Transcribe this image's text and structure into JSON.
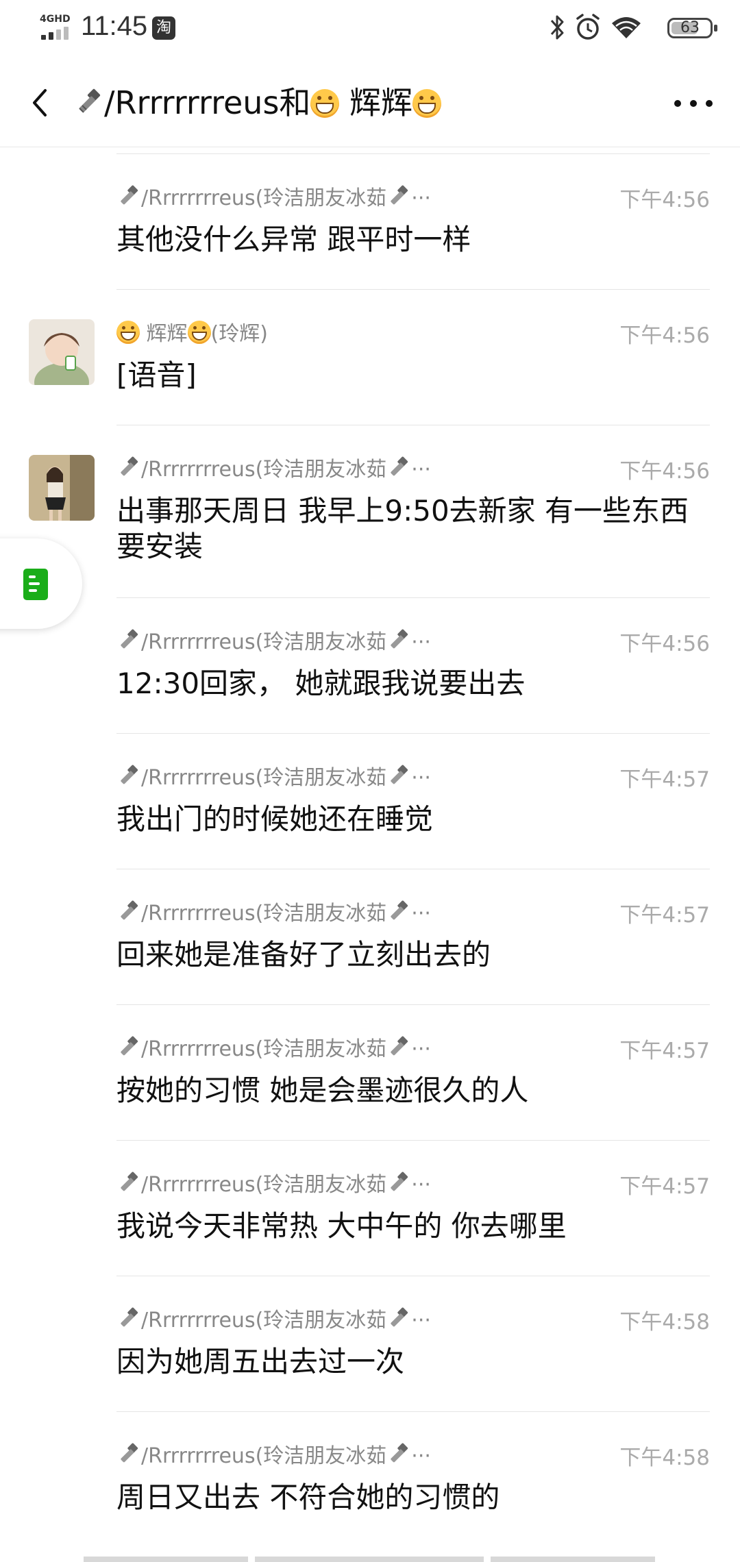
{
  "status_bar": {
    "network": "4GHD",
    "time": "11:45",
    "taobao_glyph": "淘",
    "battery": "63"
  },
  "header": {
    "title_prefix": "/Rrrrrrrreus和",
    "title_suffix": "辉辉"
  },
  "messages": [
    {
      "sender": "/Rrrrrrrreus(玲洁朋友冰茹",
      "time": "下午4:56",
      "text": "其他没什么异常  跟平时一样",
      "avatar": null
    },
    {
      "sender": "辉辉",
      "sender_suffix": "(玲辉)",
      "time": "下午4:56",
      "text": "[语音]",
      "avatar": "child"
    },
    {
      "sender": "/Rrrrrrrreus(玲洁朋友冰茹",
      "time": "下午4:56",
      "text": "出事那天周日  我早上9:50去新家 有一些东西要安装",
      "avatar": "girl"
    },
    {
      "sender": "/Rrrrrrrreus(玲洁朋友冰茹",
      "time": "下午4:56",
      "text": "12:30回家，  她就跟我说要出去",
      "avatar": null
    },
    {
      "sender": "/Rrrrrrrreus(玲洁朋友冰茹",
      "time": "下午4:57",
      "text": "我出门的时候她还在睡觉",
      "avatar": null
    },
    {
      "sender": "/Rrrrrrrreus(玲洁朋友冰茹",
      "time": "下午4:57",
      "text": "回来她是准备好了立刻出去的",
      "avatar": null
    },
    {
      "sender": "/Rrrrrrrreus(玲洁朋友冰茹",
      "time": "下午4:57",
      "text": "按她的习惯 她是会墨迹很久的人",
      "avatar": null
    },
    {
      "sender": "/Rrrrrrrreus(玲洁朋友冰茹",
      "time": "下午4:57",
      "text": "我说今天非常热 大中午的 你去哪里",
      "avatar": null
    },
    {
      "sender": "/Rrrrrrrreus(玲洁朋友冰茹",
      "time": "下午4:58",
      "text": "因为她周五出去过一次",
      "avatar": null
    },
    {
      "sender": "/Rrrrrrrreus(玲洁朋友冰茹",
      "time": "下午4:58",
      "text": "周日又出去 不符合她的习惯的",
      "avatar": null
    }
  ],
  "ellipsis": "···",
  "icons": {
    "sender_badge": "bolt-icon",
    "float": "note-icon"
  }
}
